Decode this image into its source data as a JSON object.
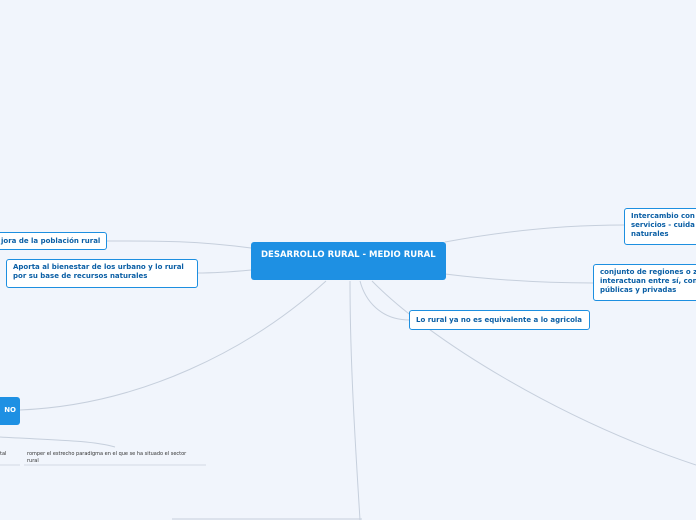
{
  "mindmap": {
    "root": "DESARROLLO RURAL - MEDIO RURAL",
    "left": {
      "mejora": "jora de la población rural",
      "aporta": "Aporta al bienestar de los urbano y lo rural por su base de recursos naturales",
      "cut_node": "NO",
      "sub_left": "tal",
      "sub_right": "romper el estrecho paradigma en el que se ha situado el sector rural"
    },
    "right": {
      "intercambio": "Intercambio con servicios - cuida naturales",
      "conjunto": "conjunto de regiones o z interactuan entre sí, con públicas y privadas",
      "rural_no_agricola": "Lo rural ya no es equivalente a lo agricola"
    }
  }
}
